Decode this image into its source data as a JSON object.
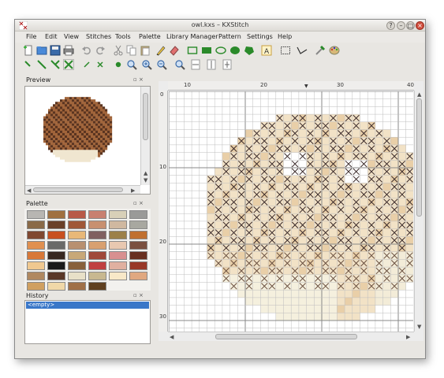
{
  "window": {
    "title": "owl.kxs – KXStitch"
  },
  "menu": [
    "File",
    "Edit",
    "View",
    "Stitches",
    "Tools",
    "Palette",
    "Library Manager",
    "Pattern",
    "Settings",
    "Help"
  ],
  "toolbar1": [
    "new-icon",
    "open-icon",
    "save-icon",
    "print-icon",
    "undo-icon",
    "redo-icon",
    "cut-icon",
    "copy-icon",
    "paste-icon",
    "pencil-icon",
    "eraser-icon",
    "draw-rectangle-icon",
    "fill-rectangle-icon",
    "draw-ellipse-icon",
    "fill-ellipse-icon",
    "fill-polygon-icon",
    "text-icon",
    "select-icon",
    "backstitch-icon",
    "color-picker-icon",
    "palette-icon"
  ],
  "toolbar2": [
    "quarter-stitch-icon",
    "half-stitch-icon",
    "three-quarter-stitch-icon",
    "full-stitch-icon",
    "small-half-stitch-icon",
    "small-full-stitch-icon",
    "french-knot-icon",
    "zoom-icon",
    "zoom-in-icon",
    "zoom-out-icon",
    "fit-page-icon",
    "fit-width-icon",
    "fit-height-icon"
  ],
  "docks": {
    "preview": {
      "title": "Preview"
    },
    "palette": {
      "title": "Palette"
    },
    "history": {
      "title": "History",
      "items": [
        "<empty>"
      ]
    }
  },
  "dock_buttons": "▫ ×",
  "palette_colors": [
    "#b8b6b2",
    "#a07040",
    "#b85a48",
    "#c88070",
    "#d8d0b8",
    "#9a9a98",
    "#8a6a48",
    "#6a4028",
    "#a05838",
    "#c89070",
    "#d0b8a0",
    "#a8a8a0",
    "#804830",
    "#c85020",
    "#e8b878",
    "#806060",
    "#9c8048",
    "#c07030",
    "#e09050",
    "#6a6a68",
    "#b89070",
    "#d8a070",
    "#e8c8b0",
    "#7a5040",
    "#d87838",
    "#382820",
    "#c8a878",
    "#a04838",
    "#d89090",
    "#683020",
    "#f0c890",
    "#1a1a1a",
    "#88603a",
    "#c04040",
    "#e0b0a0",
    "#983828",
    "#b08860",
    "#5a3828",
    "#e8e0c8",
    "#c8b890",
    "#f8e8c8",
    "#e0a880",
    "#d0a060",
    "#f0d8a8",
    "#a07048",
    "#604020"
  ],
  "ruler": {
    "top": [
      "10",
      "20",
      "30",
      "40"
    ],
    "left": [
      "0",
      "10",
      "20",
      "30"
    ]
  },
  "scroll_arrows": {
    "up": "▲",
    "down": "▼",
    "left": "◀",
    "right": "▶"
  }
}
